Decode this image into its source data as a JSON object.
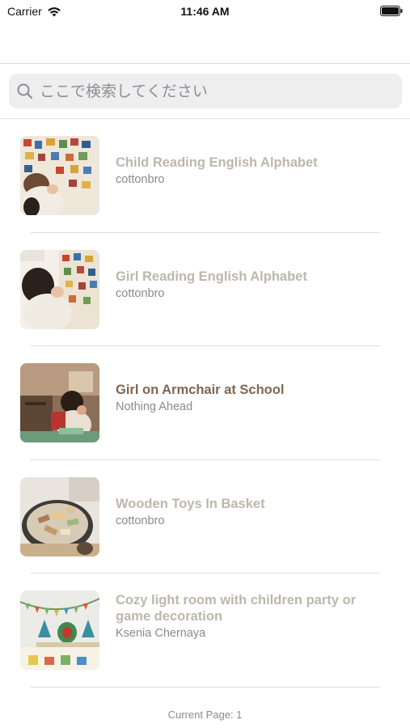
{
  "status_bar": {
    "carrier": "Carrier",
    "time": "11:46 AM"
  },
  "search": {
    "placeholder": "ここで検索してください"
  },
  "items": [
    {
      "title": "Child Reading English Alphabet",
      "author": "cottonbro",
      "thumb_icon": "photo-thumbnail"
    },
    {
      "title": "Girl Reading English Alphabet",
      "author": "cottonbro",
      "thumb_icon": "photo-thumbnail"
    },
    {
      "title": "Girl on Armchair at School",
      "author": "Nothing Ahead",
      "thumb_icon": "photo-thumbnail"
    },
    {
      "title": "Wooden Toys In Basket",
      "author": "cottonbro",
      "thumb_icon": "photo-thumbnail"
    },
    {
      "title": "Cozy light room with children party or game decoration",
      "author": "Ksenia Chernaya",
      "thumb_icon": "photo-thumbnail"
    }
  ],
  "colors": {
    "title_default": "#bdb7ab",
    "title_active": "#7d6752",
    "author": "#8a8a8a"
  },
  "footer": {
    "page_label": "Current Page: 1"
  }
}
